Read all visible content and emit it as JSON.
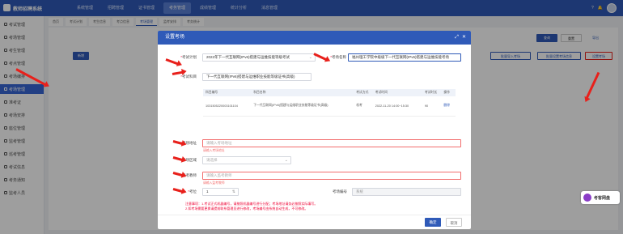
{
  "app": {
    "title": "教师招聘系统"
  },
  "topnav": [
    {
      "label": "系统管理",
      "active": false
    },
    {
      "label": "招聘管理",
      "active": false
    },
    {
      "label": "证书管理",
      "active": false
    },
    {
      "label": "考务管理",
      "active": true
    },
    {
      "label": "成绩管理",
      "active": false
    },
    {
      "label": "统计分析",
      "active": false
    },
    {
      "label": "消息管理",
      "active": false
    }
  ],
  "sidebar": [
    {
      "label": "考试管理",
      "active": false
    },
    {
      "label": "考场管理",
      "active": false
    },
    {
      "label": "考生管理",
      "active": false
    },
    {
      "label": "考点管理",
      "active": false
    },
    {
      "label": "考场编排",
      "active": false
    },
    {
      "label": "考场管理",
      "active": true
    },
    {
      "label": "准考证",
      "active": false
    },
    {
      "label": "考场安排",
      "active": false
    },
    {
      "label": "座位管理",
      "active": false
    },
    {
      "label": "监考管理",
      "active": false
    },
    {
      "label": "巡考管理",
      "active": false
    },
    {
      "label": "考试信息",
      "active": false
    },
    {
      "label": "考务通知",
      "active": false
    },
    {
      "label": "监考人员",
      "active": false
    }
  ],
  "subtabs": [
    {
      "label": "首页",
      "active": false
    },
    {
      "label": "考试计划",
      "active": false
    },
    {
      "label": "考生信息",
      "active": false
    },
    {
      "label": "考点信息",
      "active": false
    },
    {
      "label": "考场管理",
      "active": true
    },
    {
      "label": "监考安排",
      "active": false
    },
    {
      "label": "考务统计",
      "active": false
    }
  ],
  "modal": {
    "title": "设置考场",
    "controls": [
      "⤢",
      "✕"
    ],
    "plan_label": "考试计划",
    "plan_value": "2022年下一代互联网(IPv6)搭建与运维技能等级考试",
    "room_label": "考场名称",
    "room_value": "福州理工学院中级级下一代互联网(IPv6)搭建与运维技能考场",
    "subject_label": "考试科目",
    "subject_tag": "下一代互联网(IPv6)搭建与运维职业技能等级证书(高级)",
    "table_headers": [
      "科目编号",
      "科目名称",
      "考试方式",
      "考试时间",
      "考试时长",
      "操作"
    ],
    "table_rows": [
      {
        "code": "1031505220003101104",
        "name": "下一代互联网(IPv6)搭建与运维职业技能等级证书(高级)",
        "mode": "机考",
        "time": "2022-11-20 14:00~15:30",
        "duration": "90",
        "action": "删除"
      }
    ],
    "address_label": "考场地址",
    "address_placeholder": "请输入考场地址",
    "address_error": "请输入考场地址",
    "area_label": "考场区域",
    "area_placeholder": "请选择",
    "teacher_label": "监考教师",
    "teacher_placeholder": "请输入监考教师",
    "teacher_error": "请输入监考教师",
    "seats_label": "考位",
    "seats_value": "1",
    "room_no_label": "考场编号",
    "room_no_value": "系统",
    "note_lines": [
      "注意事项：1.考试正式机器编号，请按照机器编号进行分配；考场地址请务必按照实际填写。",
      "2.如考场需要更换请提前联系管理员进行修改，考场编号由系统自动生成，不可修改。"
    ],
    "confirm_label": "确定",
    "cancel_label": "取消"
  },
  "background_buttons": {
    "search": "查询",
    "reset": "重置",
    "export": "导出",
    "add": "新增",
    "settings": "设置考场",
    "import": "批量导入考场",
    "assign": "批量设置考场信息"
  },
  "badge": {
    "label": "考客网盘"
  },
  "colors": {
    "primary": "#2f5ab8",
    "error": "#f26d6d",
    "arrow": "#e8201b"
  }
}
